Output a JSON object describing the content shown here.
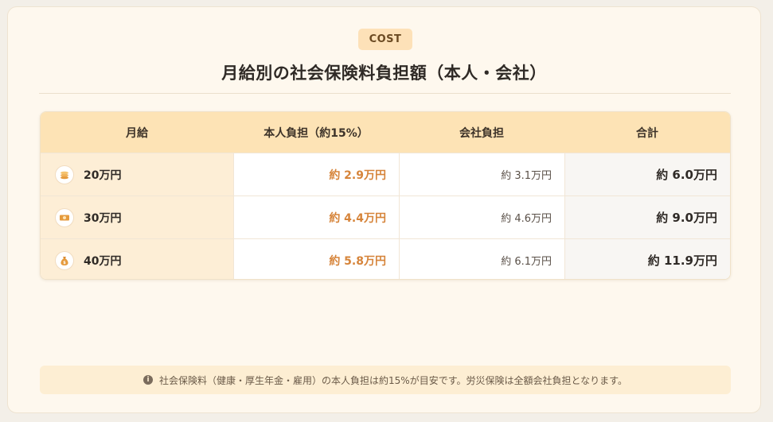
{
  "badge": "COST",
  "title": "月給別の社会保険料負担額（本人・会社）",
  "table": {
    "headers": [
      "月給",
      "本人負担（約15%）",
      "会社負担",
      "合計"
    ],
    "rows": [
      {
        "icon": "coins-stack-icon",
        "month": "20万円",
        "self": "約 2.9万円",
        "company": "約 3.1万円",
        "total": "約 6.0万円"
      },
      {
        "icon": "banknote-icon",
        "month": "30万円",
        "self": "約 4.4万円",
        "company": "約 4.6万円",
        "total": "約 9.0万円"
      },
      {
        "icon": "money-bag-icon",
        "month": "40万円",
        "self": "約 5.8万円",
        "company": "約 6.1万円",
        "total": "約 11.9万円"
      }
    ]
  },
  "note": {
    "icon": "info-icon",
    "text": "社会保険料（健康・厚生年金・雇用）の本人負担は約15%が目安です。労災保険は全額会社負担となります。"
  },
  "colors": {
    "accent": "#d6843a",
    "header_bg": "#fde3b5",
    "month_col_bg": "#fdeed6",
    "card_bg": "#fef8ee"
  }
}
